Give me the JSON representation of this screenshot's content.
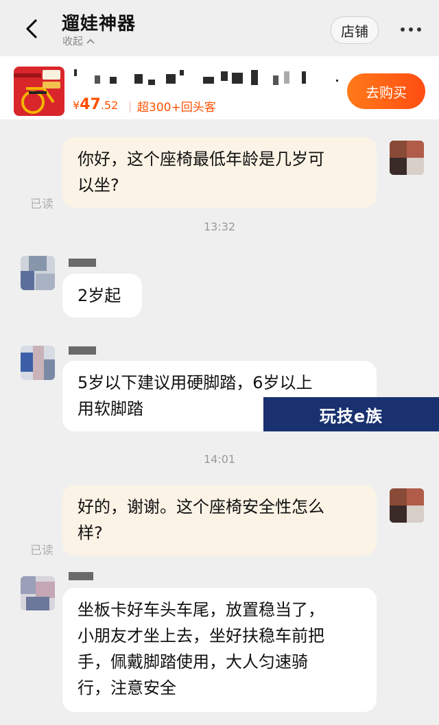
{
  "header": {
    "title": "遛娃神器",
    "collapse_label": "收起",
    "shop_label": "店铺"
  },
  "product": {
    "price_symbol": "¥",
    "price_int": "47",
    "price_dec": ".52",
    "repeat_customers": "超300+回头客",
    "buy_label": "去购买"
  },
  "messages": [
    {
      "text1": "你好，这个座椅最低年龄是几岁可",
      "text2": "以坐?",
      "status": "已读"
    },
    {
      "time": "13:32"
    },
    {
      "text1": "2岁起"
    },
    {
      "text1": "5岁以下建议用硬脚踏，6岁以上",
      "text2": "用软脚踏"
    },
    {
      "time": "14:01"
    },
    {
      "text1": "好的，谢谢。这个座椅安全性怎么",
      "text2": "样?",
      "status": "已读"
    },
    {
      "text1": "坐板卡好车头车尾，放置稳当了，",
      "text2": "小朋友才坐上去，坐好扶稳车前把",
      "text3": "手，佩戴脚踏使用，大人匀速骑",
      "text4": "行，注意安全"
    }
  ],
  "watermark": "玩技e族",
  "colors": {
    "accent": "#ff5000",
    "outgoing_bubble": "#fbf3e5",
    "incoming_bubble": "#ffffff",
    "background": "#efefef"
  }
}
